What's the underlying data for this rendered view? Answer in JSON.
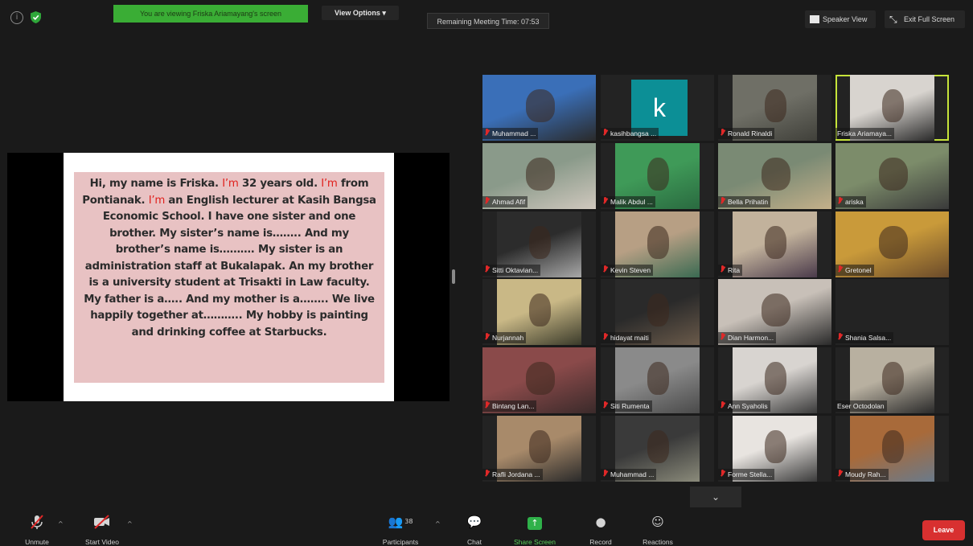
{
  "top_bar": {
    "viewing_banner": "You are viewing Friska Ariamayang's screen",
    "view_options": "View Options",
    "remaining_time": "Remaining Meeting Time: 07:53",
    "speaker_view": "Speaker View",
    "exit_full_screen": "Exit Full Screen"
  },
  "shared_slide": {
    "segments": [
      {
        "text": "Hi, my name is Friska. ",
        "red": false
      },
      {
        "text": "I’m",
        "red": true
      },
      {
        "text": " 32 years old. ",
        "red": false
      },
      {
        "text": "I’m",
        "red": true
      },
      {
        "text": " from Pontianak. ",
        "red": false
      },
      {
        "text": "I’m",
        "red": true
      },
      {
        "text": " an English lecturer at Kasih Bangsa Economic School. I have one sister and one brother. My sister’s name is…….. And my brother’s name is………. My sister is an administration staff at Bukalapak.  An my brother is a university student at Trisakti in Law faculty. My father is a….. And my mother is a…….. We live happily together at……….. My hobby is painting and drinking coffee at Starbucks.",
        "red": false
      }
    ]
  },
  "participants": [
    {
      "name": "Muhammad ...",
      "muted": true,
      "active": false
    },
    {
      "name": "kasihbangsa ...",
      "muted": true,
      "active": false,
      "avatar_letter": "k"
    },
    {
      "name": "Ronald Rinaldi",
      "muted": true,
      "active": false
    },
    {
      "name": "Friska Ariamaya...",
      "muted": false,
      "active": true
    },
    {
      "name": "Ahmad Afif",
      "muted": true,
      "active": false
    },
    {
      "name": "Malik Abdul ...",
      "muted": true,
      "active": false
    },
    {
      "name": "Bella Prihatin",
      "muted": true,
      "active": false
    },
    {
      "name": "ariska",
      "muted": true,
      "active": false
    },
    {
      "name": "Sitti Oktavian...",
      "muted": true,
      "active": false
    },
    {
      "name": "Kevin Steven",
      "muted": true,
      "active": false
    },
    {
      "name": "Rita",
      "muted": true,
      "active": false
    },
    {
      "name": "Gretonel",
      "muted": true,
      "active": false
    },
    {
      "name": "Nurjannah",
      "muted": true,
      "active": false
    },
    {
      "name": "hidayat maiti",
      "muted": true,
      "active": false
    },
    {
      "name": "Dian Harmon...",
      "muted": true,
      "active": false
    },
    {
      "name": "Shania Salsa...",
      "muted": true,
      "active": false
    },
    {
      "name": "Bintang Lan...",
      "muted": true,
      "active": false
    },
    {
      "name": "Siti Rumenta",
      "muted": true,
      "active": false
    },
    {
      "name": "Ann Syaholis",
      "muted": true,
      "active": false
    },
    {
      "name": "Eser Octodolan",
      "muted": false,
      "active": false
    },
    {
      "name": "Rafli Jordana ...",
      "muted": true,
      "active": false
    },
    {
      "name": "Muhammad ...",
      "muted": true,
      "active": false
    },
    {
      "name": "Forme Stella...",
      "muted": true,
      "active": false
    },
    {
      "name": "Moudy Rah...",
      "muted": true,
      "active": false
    }
  ],
  "toolbar": {
    "unmute": "Unmute",
    "start_video": "Start Video",
    "participants_label": "Participants",
    "participants_count": "38",
    "chat": "Chat",
    "share_screen": "Share Screen",
    "record": "Record",
    "reactions": "Reactions",
    "leave": "Leave"
  },
  "colors": {
    "banner_green": "#3aad35",
    "active_speaker": "#c6e43a",
    "leave_red": "#d83030",
    "slide_pink": "#e8c2c3"
  }
}
